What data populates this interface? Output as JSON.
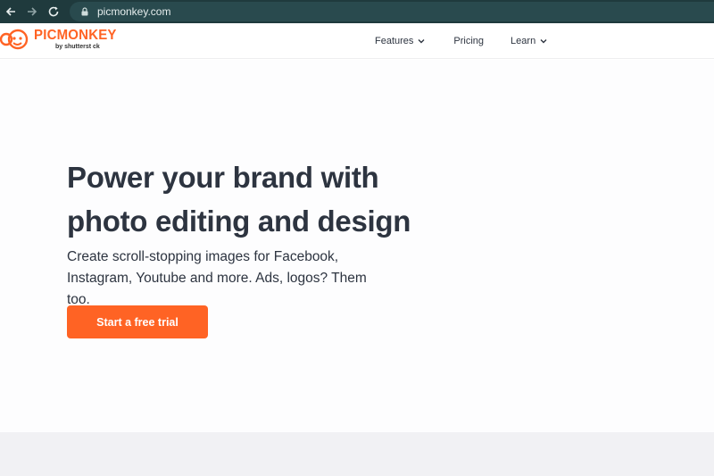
{
  "browser": {
    "url": "picmonkey.com",
    "icons": [
      "back-arrow-icon",
      "forward-arrow-icon",
      "reload-icon",
      "lock-icon"
    ]
  },
  "header": {
    "logo_word": "PICMONKEY",
    "logo_sub": "by shutterst ck",
    "nav": [
      {
        "label": "Features",
        "has_dropdown": true
      },
      {
        "label": "Pricing",
        "has_dropdown": false
      },
      {
        "label": "Learn",
        "has_dropdown": true
      }
    ]
  },
  "hero": {
    "title_line1": "Power your brand with",
    "title_line2": "photo editing and design",
    "subtitle_line1": "Create scroll-stopping images for Facebook,",
    "subtitle_line2": "Instagram, Youtube and more. Ads, logos? Them too.",
    "cta_label": "Start a free trial"
  },
  "colors": {
    "brand_orange": "#ff6324",
    "text_dark": "#2d3440",
    "browser_bar": "#1f3a3d",
    "lower_band": "#f1f1f4"
  }
}
